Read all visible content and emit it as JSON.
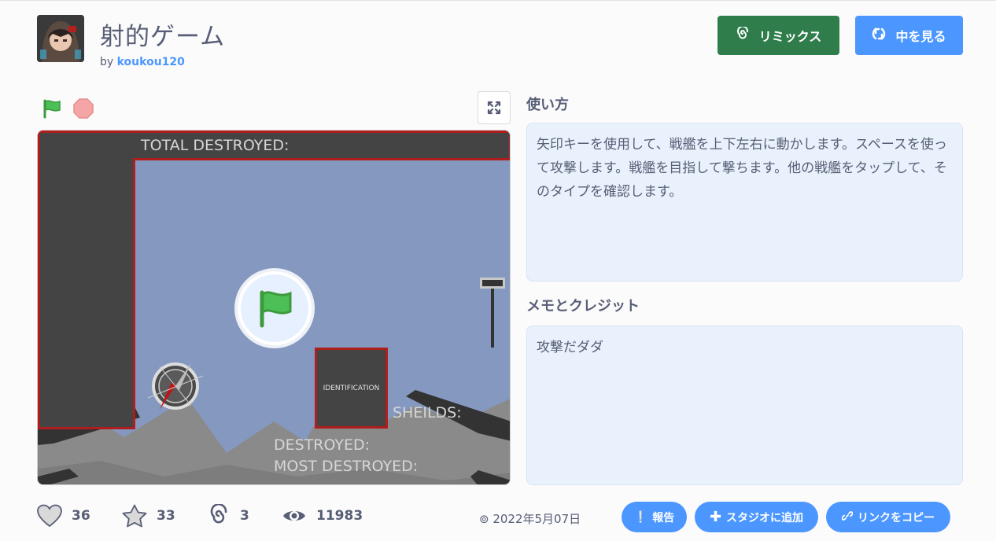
{
  "project": {
    "title": "射的ゲーム",
    "by_prefix": "by",
    "author": "koukou120"
  },
  "actions": {
    "remix_label": "リミックス",
    "see_inside_label": "中を見る"
  },
  "stage": {
    "total_destroyed": "TOTAL DESTROYED:",
    "identification": "IDENTIFICATION",
    "shields": "SHEILDS:",
    "destroyed": "DESTROYED:",
    "most_destroyed": "MOST DESTROYED:"
  },
  "instructions": {
    "heading": "使い方",
    "text": "矢印キーを使用して、戦艦を上下左右に動かします。スペースを使って攻撃します。戦艦を目指して撃ちます。他の戦艦をタップして、そのタイプを確認します。"
  },
  "notes": {
    "heading": "メモとクレジット",
    "text": "攻撃だダダ"
  },
  "stats": {
    "loves": "36",
    "favorites": "33",
    "remixes": "3",
    "views": "11983"
  },
  "footer": {
    "date": "2022年5月07日",
    "report_label": "報告",
    "add_to_studio_label": "スタジオに追加",
    "copy_link_label": "リンクをコピー"
  },
  "colors": {
    "remix_green": "#2e7d4a",
    "primary_blue": "#4c97ff",
    "stage_sky": "#8599c0",
    "panel_dark": "#444444",
    "panel_border_red": "#b01d1d"
  },
  "icons": {
    "remix": "remix-swirl-icon",
    "see_inside": "see-inside-icon",
    "green_flag": "green-flag-icon",
    "stop": "stop-icon",
    "fullscreen": "fullscreen-icon",
    "love": "heart-icon",
    "favorite": "star-icon",
    "remix_count": "remix-swirl-icon",
    "views": "eye-icon"
  }
}
